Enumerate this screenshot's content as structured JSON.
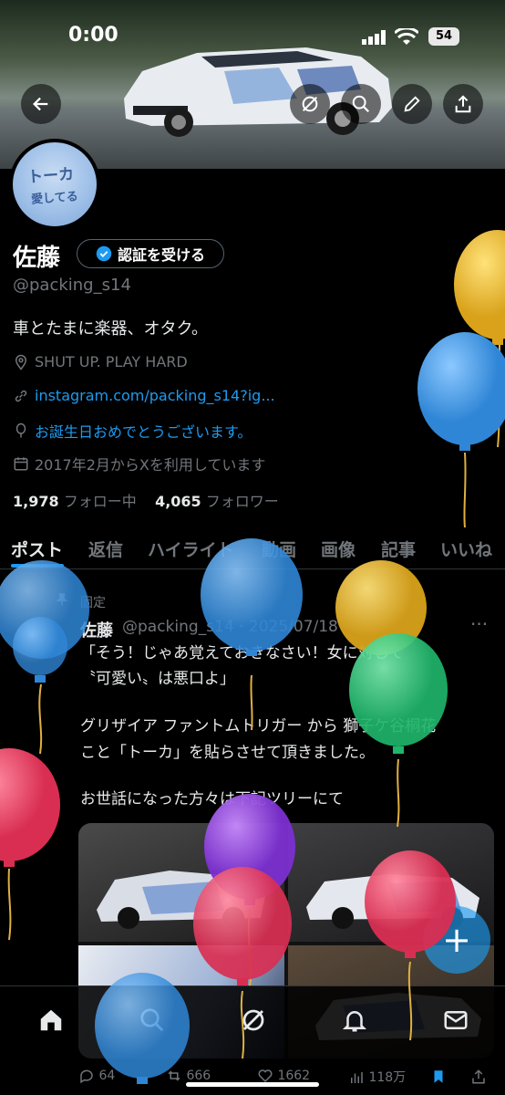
{
  "status": {
    "time": "0:00",
    "battery": "54"
  },
  "profile": {
    "avatar_text_1": "トーカ",
    "avatar_text_2": "愛してる",
    "name": "佐藤",
    "verify_label": "認証を受ける",
    "handle": "@packing_s14",
    "bio": "車とたまに楽器、オタク。",
    "location": "SHUT UP. PLAY HARD",
    "link": "instagram.com/packing_s14?ig...",
    "birthday": "お誕生日おめでとうございます。",
    "joined": "2017年2月からXを利用しています",
    "following_count": "1,978",
    "following_label": "フォロー中",
    "followers_count": "4,065",
    "followers_label": "フォロワー"
  },
  "tabs": [
    "ポスト",
    "返信",
    "ハイライト",
    "動画",
    "画像",
    "記事",
    "いいね"
  ],
  "post": {
    "pinned_label": "固定",
    "name": "佐藤",
    "handle_date": "@packing_s14 · 2025/07/18",
    "more": "···",
    "line1": "「そう！じゃあ覚えておきなさい！女に対して",
    "line2": "〝可愛い〟は悪口よ」",
    "line3": "グリザイア ファントムトリガー から 獅子ケ谷桐花",
    "line4": "こと「トーカ」を貼らさせて頂きました。",
    "line5": "お世話になった方々は下記ツリーにて",
    "replies": "64",
    "reposts": "666",
    "likes": "1662",
    "views": "118万"
  },
  "fab_label": "+",
  "colors": {
    "accent": "#1d9bf0",
    "background": "#000000",
    "muted": "#71767b"
  },
  "icons": [
    "back-arrow-icon",
    "retweet-icon",
    "search-icon",
    "edit-icon",
    "share-icon",
    "home-icon",
    "grok-icon",
    "bell-icon",
    "mail-icon",
    "bookmark-icon"
  ]
}
